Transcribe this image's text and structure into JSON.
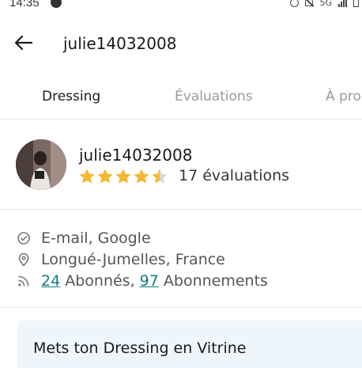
{
  "status": {
    "time": "14:35",
    "network": "5G"
  },
  "header": {
    "title": "julie14032008"
  },
  "tabs": [
    {
      "label": "Dressing"
    },
    {
      "label": "Évaluations"
    },
    {
      "label": "À pro"
    }
  ],
  "profile": {
    "name": "julie14032008",
    "rating": 4.5,
    "rating_max": 5,
    "reviews": "17 évaluations"
  },
  "info": {
    "verified": "E-mail, Google",
    "location": "Longué-Jumelles, France",
    "followers_count": "24",
    "followers_label": " Abonnés, ",
    "following_count": "97",
    "following_label": " Abonnements"
  },
  "promo": {
    "title": "Mets ton Dressing en Vitrine"
  },
  "colors": {
    "accent": "#0f7c84",
    "star": "#f5b833",
    "promo_bg": "#eef5fb"
  }
}
